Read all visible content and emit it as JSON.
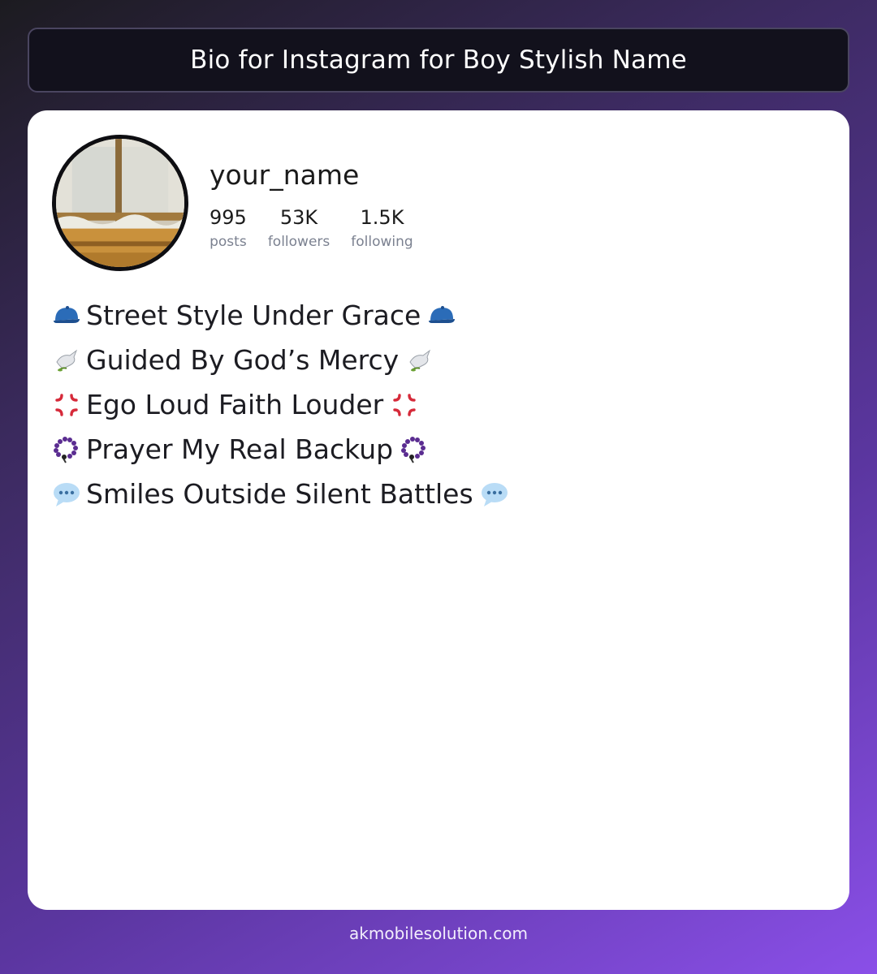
{
  "header": {
    "title": "Bio for Instagram for Boy Stylish Name"
  },
  "profile": {
    "username": "your_name",
    "stats": [
      {
        "value": "995",
        "label": "posts"
      },
      {
        "value": "53K",
        "label": "followers"
      },
      {
        "value": "1.5K",
        "label": "following"
      }
    ]
  },
  "bio": {
    "lines": [
      {
        "icon": "cap-icon",
        "text": "Street Style Under Grace"
      },
      {
        "icon": "dove-icon",
        "text": "Guided By God’s Mercy"
      },
      {
        "icon": "anger-icon",
        "text": "Ego Loud Faith Louder"
      },
      {
        "icon": "prayer-beads-icon",
        "text": "Prayer My Real Backup"
      },
      {
        "icon": "speech-bubble-icon",
        "text": "Smiles Outside Silent Battles"
      }
    ]
  },
  "footer": {
    "text": "akmobilesolution.com"
  },
  "colors": {
    "accent": "#8a4fe8",
    "card": "#ffffff",
    "title_bar": "#12111c"
  }
}
